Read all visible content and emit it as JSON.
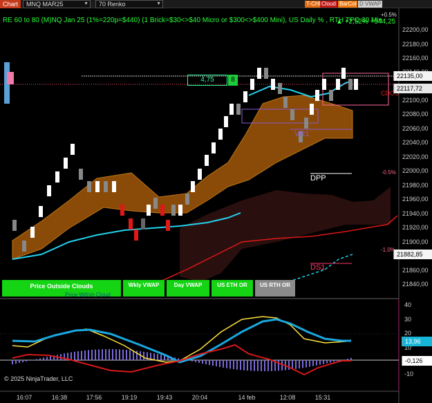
{
  "toolbar": {
    "chart_tab": "Chart",
    "instrument": "MNQ MAR25",
    "bar_type": "70 Renko",
    "btn_tchk": "T-CHK",
    "btn_cloud": "Cloud",
    "btn_barcol": "BarCol",
    "btn_dvwap": "D VWAP"
  },
  "info_line": "RE 60 to 80 (M)NQ Jan 25 (1%=220p=$440) (1 Brick=$30<>$40 Micro or $300<>$400 Mini), US Daily % , RTH TPO 30 Min",
  "move_label": "▲ ",
  "move_value": "+2,52% +544,25",
  "pct_labels": {
    "plus_half": "+0.5%",
    "minus_half": "-0.5%",
    "minus_one": "-1.0%"
  },
  "markers": {
    "box_value": "4,75",
    "box_count": "8",
    "dpp": "DPP",
    "ds1": "DS1",
    "vr1": "VR1",
    "cdos": "CDOS"
  },
  "price_axis": {
    "ticks": [
      "22200,00",
      "22180,00",
      "22160,00",
      "22140,00",
      "22100,00",
      "22080,00",
      "22060,00",
      "22040,00",
      "22020,00",
      "22000,00",
      "21980,00",
      "21960,00",
      "21940,00",
      "21920,00",
      "21900,00",
      "21860,00",
      "21840,00"
    ],
    "last_price": "22135,00",
    "current_price": "22117,72",
    "dpp_price": "21882,85"
  },
  "indicator_axis": {
    "ticks": [
      "40",
      "30",
      "20",
      "10",
      "-10"
    ],
    "value_a": "13,96",
    "value_b": "-0,126"
  },
  "buttons": {
    "price_outside": "Price Outside Clouds",
    "wkly_vwap": "Wkly VWAP",
    "day_vwap": "Day VWAP",
    "us_eth_or": "US ETH OR",
    "us_rth_or": "US RTH OR"
  },
  "faded_text": "Price Within Cloud",
  "time_axis": [
    "16:07",
    "16:38",
    "17:56",
    "19:19",
    "19:43",
    "20:04",
    "14 feb",
    "12:08",
    "15:31"
  ],
  "copyright": "© 2025 NinjaTrader, LLC",
  "colors": {
    "cloud_orange": "#8a4a08",
    "cloud_dark": "#2a0f0f",
    "cyan_line": "#22d3ee",
    "red_line": "#e01818",
    "green_info": "#2aff3a",
    "button_green": "#14d414",
    "button_grey": "#8a8a8a"
  }
}
